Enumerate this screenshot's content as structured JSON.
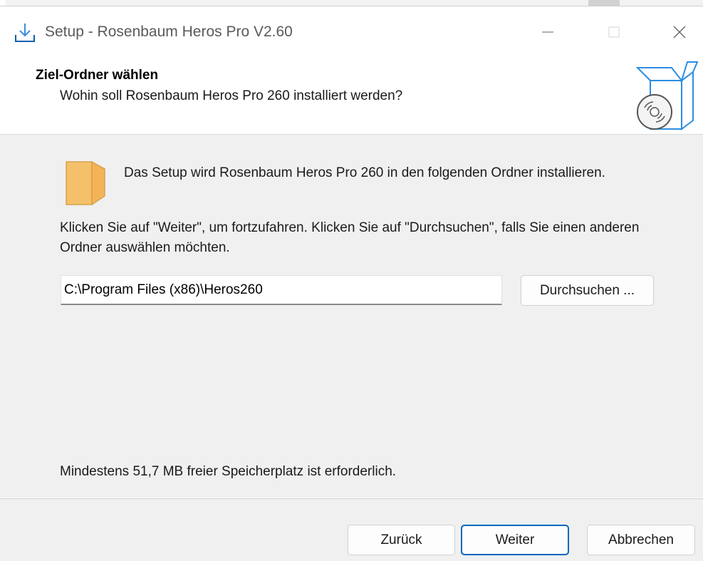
{
  "window": {
    "title": "Setup - Rosenbaum Heros Pro V2.60",
    "icons": {
      "app": "download-tray-icon",
      "minimize": "minimize-icon",
      "maximize": "maximize-icon",
      "close": "close-icon"
    }
  },
  "header": {
    "title": "Ziel-Ordner wählen",
    "subtitle": "Wohin soll Rosenbaum Heros Pro 260 installiert werden?",
    "icon": "software-box-disc-icon"
  },
  "content": {
    "folder_icon": "folder-icon",
    "intro": "Das Setup wird Rosenbaum Heros Pro 260 in den folgenden Ordner installieren.",
    "instructions": "Klicken Sie auf \"Weiter\", um fortzufahren. Klicken Sie auf \"Durchsuchen\", falls Sie einen anderen Ordner auswählen möchten.",
    "path_value": "C:\\Program Files (x86)\\Heros260",
    "browse_label": "Durchsuchen ...",
    "space_required": "Mindestens 51,7 MB freier Speicherplatz ist erforderlich."
  },
  "footer": {
    "back_label": "Zurück",
    "next_label": "Weiter",
    "cancel_label": "Abbrechen"
  },
  "colors": {
    "accent": "#0067c0",
    "content_bg": "#f0f0f0",
    "folder": "#f5c06a",
    "box_outline": "#2b8ee0"
  }
}
